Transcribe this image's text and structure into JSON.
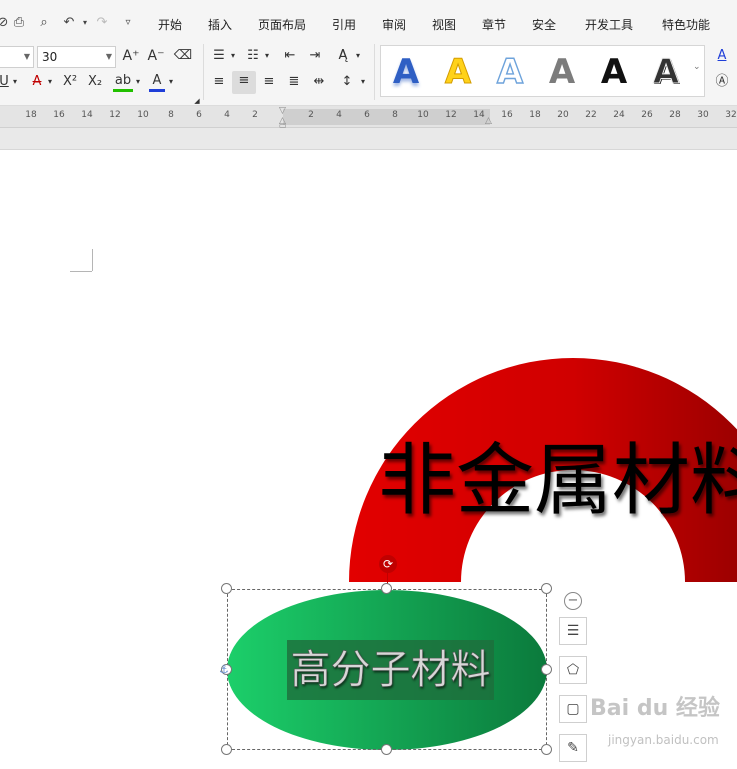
{
  "menu": {
    "tabs": [
      "开始",
      "插入",
      "页面布局",
      "引用",
      "审阅",
      "视图",
      "章节",
      "安全",
      "开发工具",
      "特色功能"
    ]
  },
  "toolbar": {
    "font_name_value": "",
    "font_size_value": "30",
    "grow_font": "A⁺",
    "shrink_font": "A⁻",
    "style_letter": "A"
  },
  "ruler": {
    "ticks": [
      "18",
      "16",
      "14",
      "12",
      "10",
      "8",
      "6",
      "4",
      "2",
      "2",
      "4",
      "6",
      "8",
      "10",
      "12",
      "14",
      "16",
      "18",
      "20",
      "22",
      "24",
      "26",
      "28",
      "30",
      "32"
    ]
  },
  "document": {
    "arch_title": "非金属材料",
    "oval_text": "高分子材料"
  },
  "colors": {
    "arch_start": "#e20000",
    "arch_end": "#8a0000",
    "oval_start": "#1ccf6a",
    "oval_end": "#0b7a3c"
  },
  "watermark": {
    "brand": "Bai du 经验",
    "url": "jingyan.baidu.com"
  }
}
